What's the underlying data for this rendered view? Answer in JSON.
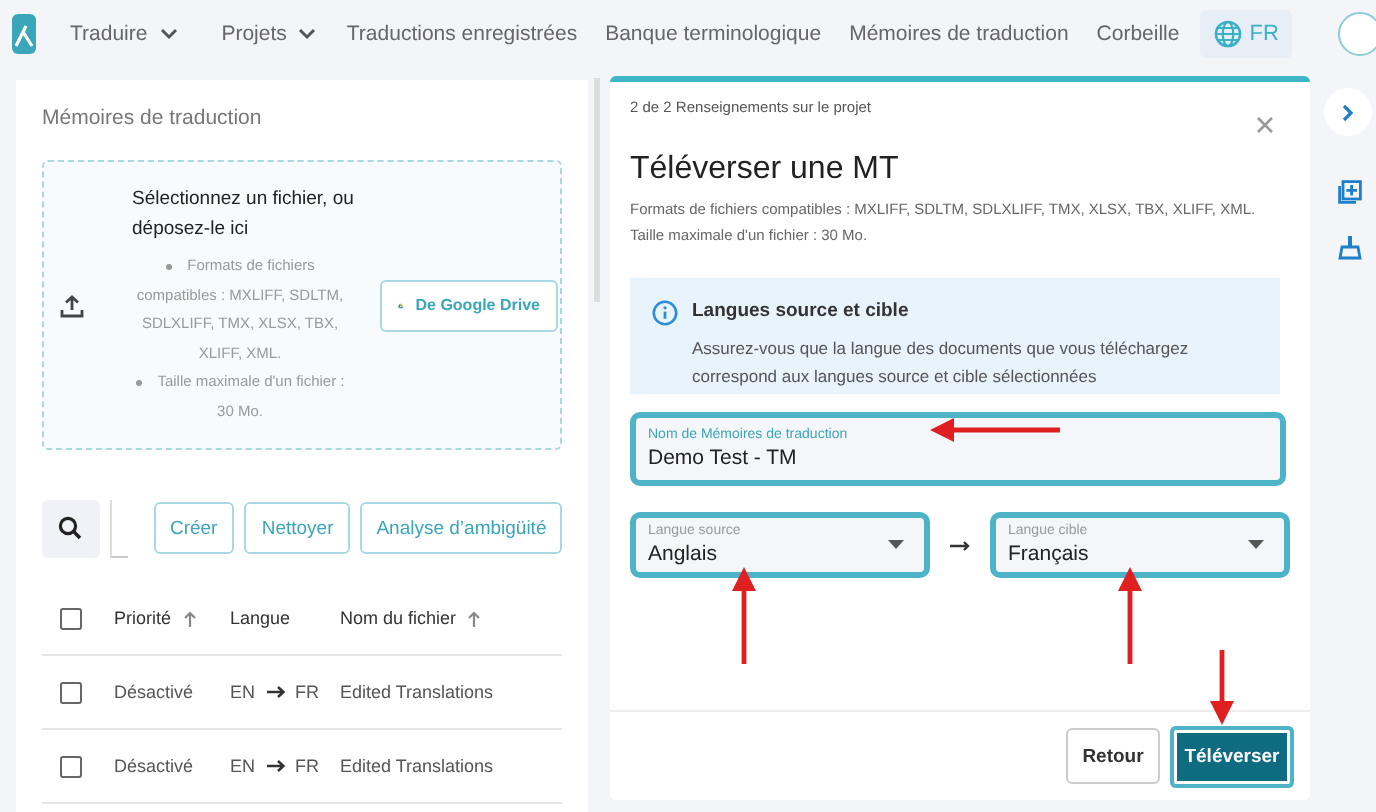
{
  "nav": {
    "items": [
      {
        "label": "Traduire",
        "dropdown": true
      },
      {
        "label": "Projets",
        "dropdown": true
      },
      {
        "label": "Traductions enregistrées",
        "dropdown": false
      },
      {
        "label": "Banque terminologique",
        "dropdown": false
      },
      {
        "label": "Mémoires de traduction",
        "dropdown": false
      },
      {
        "label": "Corbeille",
        "dropdown": false
      }
    ],
    "language": "FR"
  },
  "left": {
    "title": "Mémoires de traduction",
    "upload": {
      "heading": "Sélectionnez un fichier, ou déposez-le ici",
      "bullets": [
        "Formats de fichiers compatibles : MXLIFF, SDLTM, SDLXLIFF, TMX, XLSX, TBX, XLIFF, XML.",
        "Taille maximale d'un fichier : 30 Mo."
      ],
      "drive_button": "De Google Drive"
    },
    "toolbar": [
      "Créer",
      "Nettoyer",
      "Analyse d’ambigüité"
    ],
    "table": {
      "select_all_checked": false,
      "columns": [
        {
          "label": "Priorité",
          "sortable": true
        },
        {
          "label": "Langue",
          "sortable": false
        },
        {
          "label": "Nom du fichier",
          "sortable": true
        }
      ],
      "rows": [
        {
          "checked": false,
          "priority": "Désactivé",
          "source": "EN",
          "target": "FR",
          "file": "Edited Translations"
        },
        {
          "checked": false,
          "priority": "Désactivé",
          "source": "EN",
          "target": "FR",
          "file": "Edited Translations"
        }
      ]
    }
  },
  "modal": {
    "step": "2 de 2 Renseignements sur le projet",
    "title": "Téléverser une MT",
    "formats": "Formats de fichiers compatibles : MXLIFF, SDLTM, SDLXLIFF, TMX, XLSX, TBX, XLIFF, XML. Taille maximale d'un fichier : 30 Mo.",
    "info": {
      "title": "Langues source et cible",
      "text": "Assurez-vous que la langue des documents que vous téléchargez correspond aux langues source et cible sélectionnées"
    },
    "name_field": {
      "label": "Nom de Mémoires de traduction",
      "value": "Demo Test - TM",
      "highlighted": true
    },
    "source": {
      "label": "Langue source",
      "value": "Anglais",
      "highlighted": true
    },
    "target": {
      "label": "Langue cible",
      "value": "Français",
      "highlighted": true
    },
    "buttons": [
      {
        "label": "Retour",
        "kind": "secondary",
        "highlighted": false
      },
      {
        "label": "Téléverser",
        "kind": "primary",
        "highlighted": true
      }
    ]
  },
  "annotations": [
    {
      "kind": "left"
    },
    {
      "kind": "up"
    },
    {
      "kind": "up"
    },
    {
      "kind": "down"
    }
  ]
}
